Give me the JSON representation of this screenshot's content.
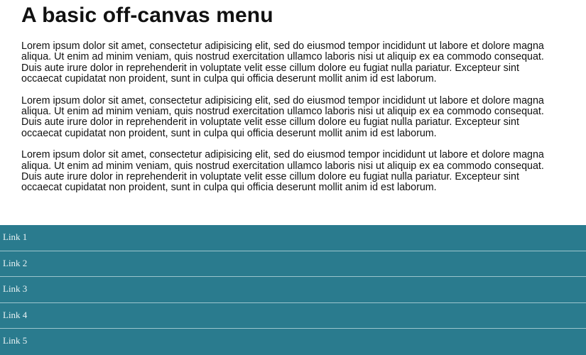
{
  "page": {
    "title": "A basic off-canvas menu",
    "paragraphs": [
      "Lorem ipsum dolor sit amet, consectetur adipisicing elit, sed do eiusmod tempor incididunt ut labore et dolore magna aliqua. Ut enim ad minim veniam, quis nostrud exercitation ullamco laboris nisi ut aliquip ex ea commodo consequat. Duis aute irure dolor in reprehenderit in voluptate velit esse cillum dolore eu fugiat nulla pariatur. Excepteur sint occaecat cupidatat non proident, sunt in culpa qui officia deserunt mollit anim id est laborum.",
      "Lorem ipsum dolor sit amet, consectetur adipisicing elit, sed do eiusmod tempor incididunt ut labore et dolore magna aliqua. Ut enim ad minim veniam, quis nostrud exercitation ullamco laboris nisi ut aliquip ex ea commodo consequat. Duis aute irure dolor in reprehenderit in voluptate velit esse cillum dolore eu fugiat nulla pariatur. Excepteur sint occaecat cupidatat non proident, sunt in culpa qui officia deserunt mollit anim id est laborum.",
      "Lorem ipsum dolor sit amet, consectetur adipisicing elit, sed do eiusmod tempor incididunt ut labore et dolore magna aliqua. Ut enim ad minim veniam, quis nostrud exercitation ullamco laboris nisi ut aliquip ex ea commodo consequat. Duis aute irure dolor in reprehenderit in voluptate velit esse cillum dolore eu fugiat nulla pariatur. Excepteur sint occaecat cupidatat non proident, sunt in culpa qui officia deserunt mollit anim id est laborum."
    ]
  },
  "menu": {
    "background_color": "#2a7b8e",
    "divider_color": "#9cc5cd",
    "links": [
      {
        "label": "Link 1"
      },
      {
        "label": "Link 2"
      },
      {
        "label": "Link 3"
      },
      {
        "label": "Link 4"
      },
      {
        "label": "Link 5"
      }
    ]
  }
}
